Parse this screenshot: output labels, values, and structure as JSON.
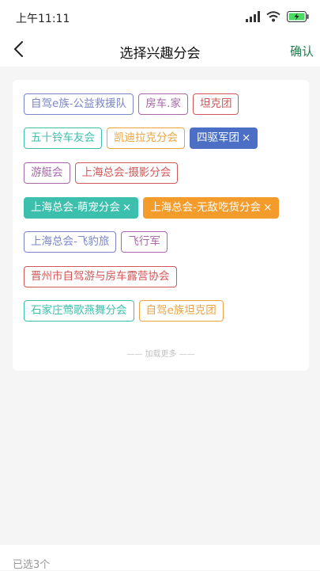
{
  "status_bar": {
    "time": "上午11:11",
    "icons": [
      "signal-icon",
      "wifi-icon",
      "battery-charging-icon"
    ],
    "battery_color": "#4cd964"
  },
  "nav": {
    "back_icon": "chevron-left-icon",
    "title": "选择兴趣分会",
    "confirm_label": "确认",
    "confirm_color": "#1a7f4d"
  },
  "tags": [
    {
      "label": "自驾e族-公益救援队",
      "color": "#7a86c8",
      "selected": false
    },
    {
      "label": "房车.家",
      "color": "#a768a8",
      "selected": false
    },
    {
      "label": "坦克团",
      "color": "#d05858",
      "selected": false
    },
    {
      "label": "五十铃车友会",
      "color": "#3dbfae",
      "selected": false
    },
    {
      "label": "凯迪拉克分会",
      "color": "#e9a440",
      "selected": false
    },
    {
      "label": "四驱军团",
      "color": "#4a6fc4",
      "selected": true
    },
    {
      "label": "游艇会",
      "color": "#a768a8",
      "selected": false
    },
    {
      "label": "上海总会-摄影分会",
      "color": "#d05858",
      "selected": false
    },
    {
      "label": "上海总会-萌宠分会",
      "color": "#3dbfae",
      "selected": true
    },
    {
      "label": "上海总会-无敌吃货分会",
      "color": "#f39c2c",
      "selected": true
    },
    {
      "label": "上海总会-飞豹旅",
      "color": "#7a86c8",
      "selected": false
    },
    {
      "label": "飞行军",
      "color": "#a768a8",
      "selected": false
    },
    {
      "label": "晋州市自驾游与房车露营协会",
      "color": "#d05858",
      "selected": false
    },
    {
      "label": "石家庄莺歌燕舞分会",
      "color": "#3dbfae",
      "selected": false
    },
    {
      "label": "自驾e族坦克团",
      "color": "#e9a440",
      "selected": false
    }
  ],
  "remove_mark": "×",
  "load_more": "—— 加载更多 ——",
  "footer": {
    "selected_count": "已选3个"
  }
}
